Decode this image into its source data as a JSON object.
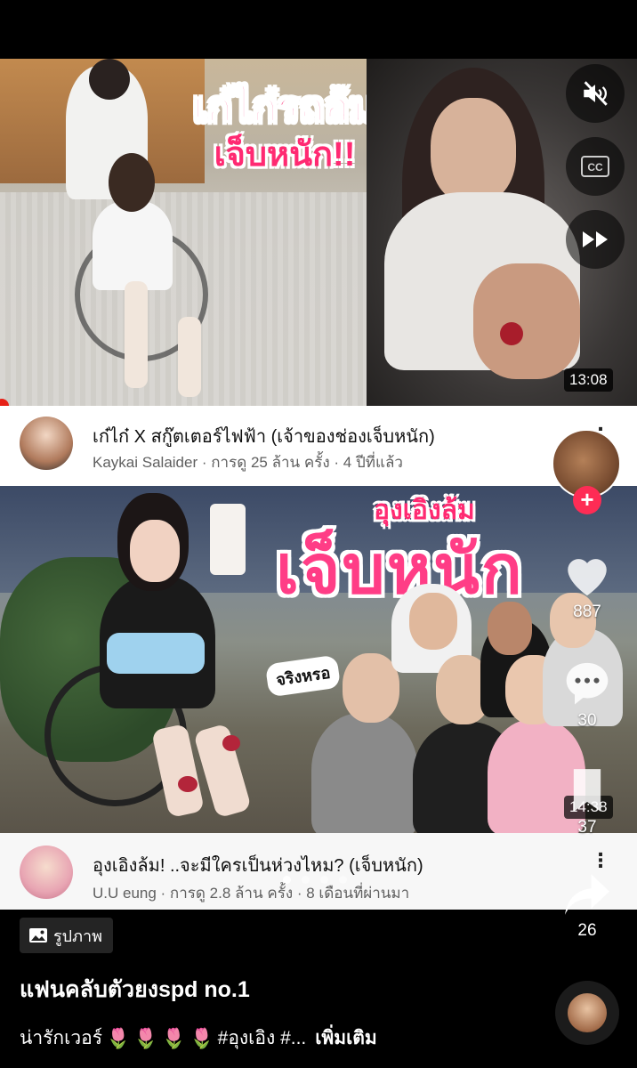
{
  "video1": {
    "thumb_title_line1": "เก๋ไก๋รถล้ม",
    "thumb_title_line2": "เจ็บหนัก!!",
    "duration": "13:08",
    "title": "เก๋ไก๋ X สกู๊ตเตอร์ไฟฟ้า (เจ้าของช่องเจ็บหนัก)",
    "channel_meta": "Kaykai Salaider · การดู 25 ล้าน ครั้ง · 4 ปีที่แล้ว"
  },
  "video2": {
    "thumb_title_small": "อุงเอิงล้ม",
    "thumb_title_big": "เจ็บหนัก",
    "bubble": "จริงหรอ",
    "exclaim": "!!",
    "duration": "14:38",
    "title": "อุงเอิงล้ม! ..จะมีใครเป็นห่วงไหม? (เจ็บหนัก)",
    "channel_meta": "U.U eung · การดู 2.8 ล้าน ครั้ง · 8 เดือนที่ผ่านมา"
  },
  "actions": {
    "likes": "887",
    "comments": "30",
    "saves": "37",
    "shares": "26",
    "follow_symbol": "+"
  },
  "post": {
    "photo_chip_label": "รูปภาพ",
    "author": "แฟนคลับตัวยงspd no.1",
    "caption_text": "น่ารักเวอร์",
    "caption_tag": "#อุงเอิง #...",
    "caption_more": "เพิ่มเติม",
    "carousel_count": 4,
    "carousel_active": 1
  },
  "colors": {
    "tiktok_red": "#fe2c55",
    "thumb_pink": "#ff2a72",
    "youtube_red": "#e62117"
  }
}
